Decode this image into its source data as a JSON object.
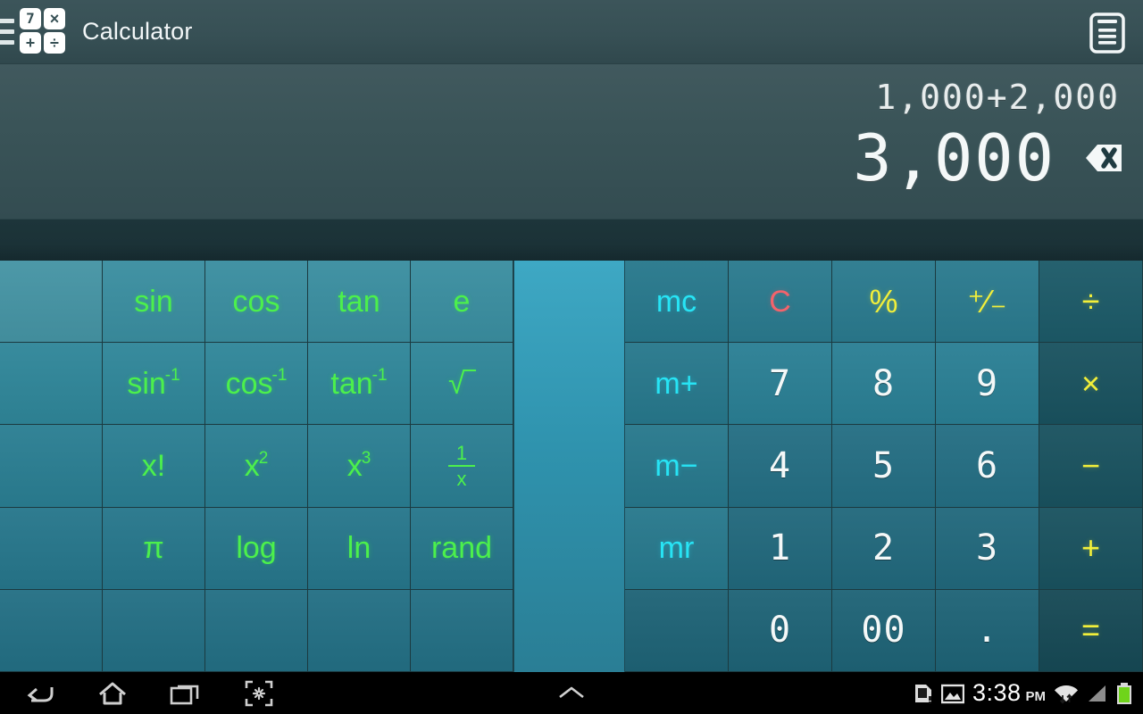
{
  "titlebar": {
    "app_title": "Calculator",
    "menu_icon": "hamburger-menu-icon",
    "app_icon": "calculator-app-icon",
    "app_icon_keys": [
      "7",
      "×",
      "+",
      "÷"
    ],
    "history_icon": "clipboard-history-icon"
  },
  "display": {
    "expression": "1,000+2,000",
    "result": "3,000",
    "backspace_icon": "backspace-delete-icon"
  },
  "colors": {
    "scientific_green": "#4cf04c",
    "memory_cyan": "#27e4f5",
    "clear_red": "#f4636b",
    "operator_yellow": "#f2ef3a",
    "digit_white": "#f4f8f8",
    "key_teal": "#2a7e92",
    "divider_teal": "#2f93ae",
    "display_bg": "#3a5458"
  },
  "keypad_left": {
    "rows": [
      [
        {
          "label": "",
          "kind": "blank"
        },
        {
          "label": "sin",
          "kind": "sci"
        },
        {
          "label": "cos",
          "kind": "sci"
        },
        {
          "label": "tan",
          "kind": "sci"
        },
        {
          "label": "e",
          "kind": "sci"
        }
      ],
      [
        {
          "label": "",
          "kind": "blank"
        },
        {
          "label": "sin",
          "sup": "-1",
          "kind": "sci"
        },
        {
          "label": "cos",
          "sup": "-1",
          "kind": "sci"
        },
        {
          "label": "tan",
          "sup": "-1",
          "kind": "sci"
        },
        {
          "label": "√‾",
          "kind": "sqrt"
        }
      ],
      [
        {
          "label": "",
          "kind": "blank"
        },
        {
          "label": "x!",
          "kind": "sci"
        },
        {
          "label": "x",
          "sup": "2",
          "kind": "sci"
        },
        {
          "label": "x",
          "sup": "3",
          "kind": "sci"
        },
        {
          "label": "1/x",
          "kind": "frac",
          "num": "1",
          "den": "x"
        }
      ],
      [
        {
          "label": "",
          "kind": "blank"
        },
        {
          "label": "π",
          "kind": "sci"
        },
        {
          "label": "log",
          "kind": "sci"
        },
        {
          "label": "ln",
          "kind": "sci"
        },
        {
          "label": "rand",
          "kind": "sci"
        }
      ],
      [
        {
          "label": "",
          "kind": "blank"
        },
        {
          "label": "",
          "kind": "blank"
        },
        {
          "label": "",
          "kind": "blank"
        },
        {
          "label": "",
          "kind": "blank"
        },
        {
          "label": "",
          "kind": "blank"
        }
      ]
    ]
  },
  "keypad_right": {
    "rows": [
      [
        {
          "label": "mc",
          "kind": "mem"
        },
        {
          "label": "C",
          "kind": "clr"
        },
        {
          "label": "%",
          "kind": "op"
        },
        {
          "label": "+/-",
          "kind": "plusminus"
        },
        {
          "label": "÷",
          "kind": "op"
        }
      ],
      [
        {
          "label": "m+",
          "kind": "mem"
        },
        {
          "label": "7",
          "kind": "dig"
        },
        {
          "label": "8",
          "kind": "dig"
        },
        {
          "label": "9",
          "kind": "dig"
        },
        {
          "label": "×",
          "kind": "op"
        }
      ],
      [
        {
          "label": "m−",
          "kind": "mem"
        },
        {
          "label": "4",
          "kind": "dig"
        },
        {
          "label": "5",
          "kind": "dig"
        },
        {
          "label": "6",
          "kind": "dig"
        },
        {
          "label": "−",
          "kind": "op"
        }
      ],
      [
        {
          "label": "mr",
          "kind": "mem"
        },
        {
          "label": "1",
          "kind": "dig"
        },
        {
          "label": "2",
          "kind": "dig"
        },
        {
          "label": "3",
          "kind": "dig"
        },
        {
          "label": "+",
          "kind": "op"
        }
      ],
      [
        {
          "label": "",
          "kind": "blank"
        },
        {
          "label": "0",
          "kind": "dig"
        },
        {
          "label": "00",
          "kind": "dig"
        },
        {
          "label": ".",
          "kind": "dig"
        },
        {
          "label": "=",
          "kind": "op"
        }
      ]
    ]
  },
  "divider": {
    "name": "panel-divider-handle"
  },
  "navbar": {
    "back_icon": "back-arrow-icon",
    "home_icon": "home-icon",
    "recents_icon": "recent-apps-icon",
    "screenshot_icon": "screenshot-capture-icon",
    "expand_icon": "chevron-up-icon"
  },
  "statusbar": {
    "sd_card_icon": "sd-card-warning-icon",
    "screenshot_saved_icon": "image-saved-icon",
    "time": "3:38",
    "ampm": "PM",
    "wifi_icon": "wifi-data-icon",
    "signal_icon": "cellular-signal-icon",
    "battery_icon": "battery-full-icon"
  }
}
